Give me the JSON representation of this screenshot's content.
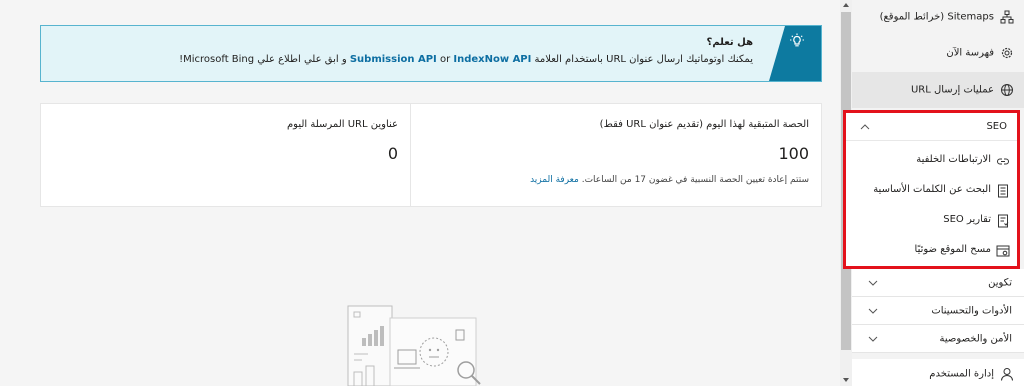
{
  "tip": {
    "title": "هل تعلم؟",
    "body_prefix": "يمكنك اوتوماتيك ارسال عنوان URL باستخدام العلامة",
    "api1": "IndexNow API",
    "or": "or",
    "api2": "Submission API",
    "body_suffix": "و ابق علي اطلاع علي Microsoft Bing!",
    "icon": "lightbulb-icon"
  },
  "stats": {
    "quota_label": "الحصة المتبقية لهذا اليوم (تقديم عنوان URL فقط)",
    "quota_value": "100",
    "quota_note": "ستتم إعادة تعيين الحصة النسبية في غضون 17 من الساعات.",
    "learn_more": "معرفة المزيد",
    "submitted_label": "عناوين URL المرسلة اليوم",
    "submitted_value": "0"
  },
  "sidebar": {
    "items": [
      {
        "label": "Sitemaps (خرائط الموقع)",
        "icon": "sitemap-icon"
      },
      {
        "label": "فهرسة الآن",
        "icon": "gear-icon"
      },
      {
        "label": "عمليات إرسال URL",
        "icon": "globe-icon"
      }
    ],
    "seo": {
      "label": "SEO",
      "items": [
        {
          "label": "الارتباطات الخلفية",
          "icon": "link-icon"
        },
        {
          "label": "البحث عن الكلمات الأساسية",
          "icon": "document-icon"
        },
        {
          "label": "تقارير SEO",
          "icon": "report-icon"
        },
        {
          "label": "مسح الموقع ضوئيًا",
          "icon": "scan-icon"
        }
      ]
    },
    "sections": [
      {
        "label": "تكوين"
      },
      {
        "label": "الأدوات والتحسينات"
      },
      {
        "label": "الأمن والخصوصية"
      },
      {
        "label": "إدارة المستخدم",
        "icon": "user-icon"
      }
    ]
  },
  "colors": {
    "accent": "#0d7aa0",
    "highlight": "#e3111b",
    "link": "#0d6ea2"
  }
}
